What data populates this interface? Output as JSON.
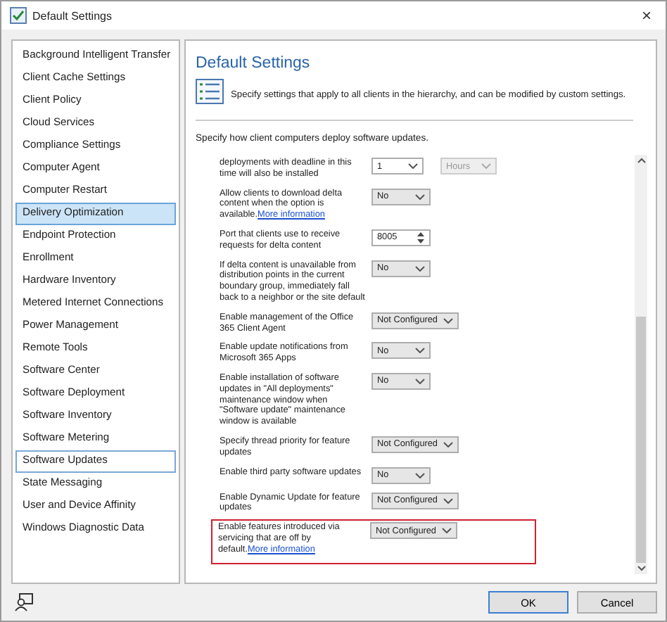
{
  "window": {
    "title": "Default Settings",
    "close": "×"
  },
  "sidebar": {
    "items": [
      {
        "label": "Background Intelligent Transfer",
        "selected": false,
        "focused": false
      },
      {
        "label": "Client Cache Settings",
        "selected": false,
        "focused": false
      },
      {
        "label": "Client Policy",
        "selected": false,
        "focused": false
      },
      {
        "label": "Cloud Services",
        "selected": false,
        "focused": false
      },
      {
        "label": "Compliance Settings",
        "selected": false,
        "focused": false
      },
      {
        "label": "Computer Agent",
        "selected": false,
        "focused": false
      },
      {
        "label": "Computer Restart",
        "selected": false,
        "focused": false
      },
      {
        "label": "Delivery Optimization",
        "selected": true,
        "focused": false
      },
      {
        "label": "Endpoint Protection",
        "selected": false,
        "focused": false
      },
      {
        "label": "Enrollment",
        "selected": false,
        "focused": false
      },
      {
        "label": "Hardware Inventory",
        "selected": false,
        "focused": false
      },
      {
        "label": "Metered Internet Connections",
        "selected": false,
        "focused": false
      },
      {
        "label": "Power Management",
        "selected": false,
        "focused": false
      },
      {
        "label": "Remote Tools",
        "selected": false,
        "focused": false
      },
      {
        "label": "Software Center",
        "selected": false,
        "focused": false
      },
      {
        "label": "Software Deployment",
        "selected": false,
        "focused": false
      },
      {
        "label": "Software Inventory",
        "selected": false,
        "focused": false
      },
      {
        "label": "Software Metering",
        "selected": false,
        "focused": false
      },
      {
        "label": "Software Updates",
        "selected": false,
        "focused": true
      },
      {
        "label": "State Messaging",
        "selected": false,
        "focused": false
      },
      {
        "label": "User and Device Affinity",
        "selected": false,
        "focused": false
      },
      {
        "label": "Windows Diagnostic Data",
        "selected": false,
        "focused": false
      }
    ]
  },
  "panel": {
    "title": "Default Settings",
    "description": "Specify settings that apply to all clients in the hierarchy, and can be modified by custom settings.",
    "section": "Specify how client computers deploy software updates.",
    "settings": [
      {
        "label": "deployments with deadline in this time will also be installed",
        "kind": "pair",
        "value": "1",
        "value2": "Hours",
        "highlighted": false
      },
      {
        "label": "Allow clients to download delta content when the option is available.",
        "link": "More information",
        "kind": "dropdown",
        "value": "No",
        "highlighted": false
      },
      {
        "label": "Port that clients use to receive requests for delta content",
        "kind": "spin",
        "value": "8005",
        "highlighted": false
      },
      {
        "label": "If delta content is unavailable from distribution points in the current boundary group, immediately fall back to a neighbor or the site default",
        "kind": "dropdown",
        "value": "No",
        "highlighted": false
      },
      {
        "label": "Enable management of the Office 365 Client Agent",
        "kind": "dropdown",
        "value": "Not Configured",
        "highlighted": false
      },
      {
        "label": "Enable update notifications from Microsoft 365 Apps",
        "kind": "dropdown",
        "value": "No",
        "highlighted": false
      },
      {
        "label": "Enable installation of software updates in \"All deployments\" maintenance window when \"Software update\" maintenance window is available",
        "kind": "dropdown",
        "value": "No",
        "highlighted": false
      },
      {
        "label": "Specify thread priority for feature updates",
        "kind": "dropdown",
        "value": "Not Configured",
        "highlighted": false
      },
      {
        "label": "Enable third party software updates",
        "kind": "dropdown",
        "value": "No",
        "highlighted": false
      },
      {
        "label": "Enable Dynamic Update for feature updates",
        "kind": "dropdown",
        "value": "Not Configured",
        "highlighted": false
      },
      {
        "label": "Enable features introduced via servicing that are off by default.",
        "link": "More information",
        "kind": "dropdown",
        "value": "Not Configured",
        "highlighted": true
      }
    ]
  },
  "buttons": [
    {
      "label": "OK",
      "default": true
    },
    {
      "label": "Cancel",
      "default": false
    }
  ]
}
